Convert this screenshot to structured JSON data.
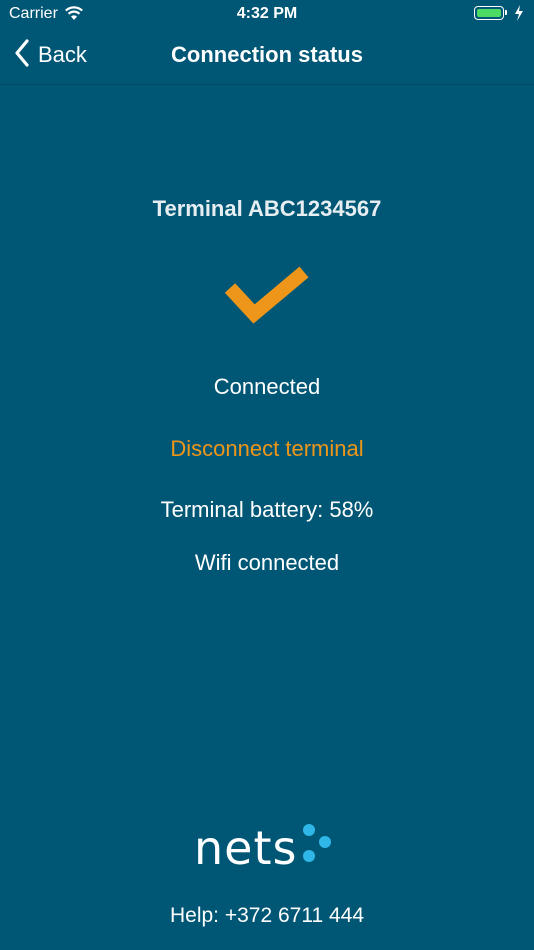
{
  "status_bar": {
    "carrier": "Carrier",
    "time": "4:32 PM",
    "icons": [
      "wifi-icon",
      "battery-icon",
      "charging-bolt-icon"
    ]
  },
  "nav": {
    "back_label": "Back",
    "title": "Connection status"
  },
  "terminal": {
    "name": "Terminal ABC1234567",
    "status": "Connected",
    "disconnect_label": "Disconnect terminal",
    "battery": "Terminal battery: 58%",
    "wifi": "Wifi connected"
  },
  "footer": {
    "logo_text": "nets",
    "help": "Help: +372 6711 444"
  },
  "colors": {
    "background": "#005775",
    "accent": "#ee9619",
    "logo_dots": "#2fb7e8"
  }
}
